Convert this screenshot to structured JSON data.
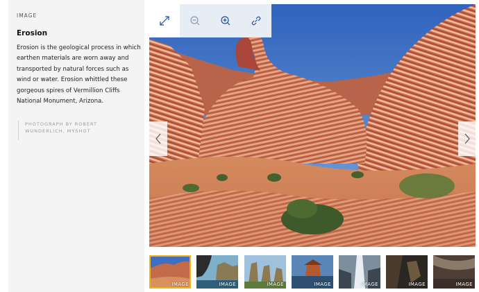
{
  "caption": {
    "eyebrow": "IMAGE",
    "title": "Erosion",
    "description": "Erosion is the geological process in which earthen materials are worn away and transported by natural forces such as wind or water. Erosion whittled these gorgeous spires of Vermillion Cliffs National Monument, Arizona.",
    "credit_line_1": "PHOTOGRAPH BY ROBERT",
    "credit_line_2": "WUNDERLICH, MYSHOT"
  },
  "toolbar": {
    "icons": [
      "expand-icon",
      "zoom-out-icon",
      "zoom-in-icon",
      "link-icon"
    ]
  },
  "navigation": {
    "prev_icon": "chevron-left-icon",
    "next_icon": "chevron-right-icon"
  },
  "thumbnails": [
    {
      "label": "IMAGE",
      "active": true
    },
    {
      "label": "IMAGE",
      "active": false
    },
    {
      "label": "IMAGE",
      "active": false
    },
    {
      "label": "IMAGE",
      "active": false
    },
    {
      "label": "IMAGE",
      "active": false
    },
    {
      "label": "IMAGE",
      "active": false
    },
    {
      "label": "IMAGE",
      "active": false
    }
  ],
  "colors": {
    "sidebar_bg": "#f4f4f4",
    "toolbar_active_bg": "#e7edf5",
    "thumb_active_border": "#f0b418",
    "sky": "#3b6fc4",
    "rock": "#c76a4a"
  }
}
